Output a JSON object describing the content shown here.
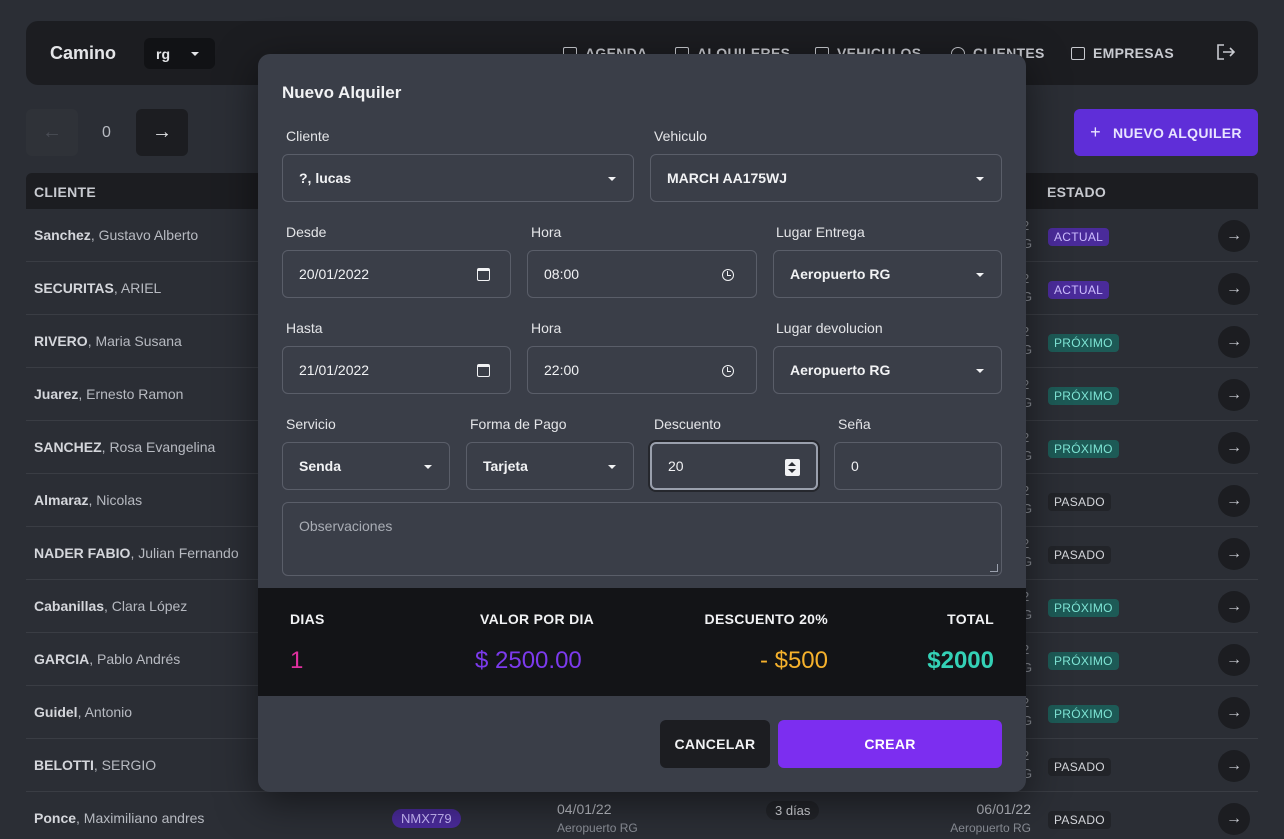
{
  "navbar": {
    "brand": "Camino",
    "company_select": "rg",
    "items": [
      {
        "label": "AGENDA"
      },
      {
        "label": "ALQUILERES"
      },
      {
        "label": "VEHICULOS"
      },
      {
        "label": "CLIENTES"
      },
      {
        "label": "EMPRESAS"
      }
    ]
  },
  "pager": {
    "page": "0",
    "prev_icon": "←",
    "next_icon": "→"
  },
  "new_button": {
    "icon": "+",
    "label": "NUEVO ALQUILER"
  },
  "table": {
    "headers": {
      "cliente": "CLIENTE",
      "estado": "ESTADO"
    },
    "rows": [
      {
        "last": "Sanchez",
        "first": ", Gustavo Alberto",
        "edge1": "2",
        "edge2": "G",
        "status": "ACTUAL"
      },
      {
        "last": "SECURITAS",
        "first": ", ARIEL",
        "edge1": "2",
        "edge2": "G",
        "status": "ACTUAL"
      },
      {
        "last": "RIVERO",
        "first": ", Maria Susana",
        "edge1": "2",
        "edge2": "G",
        "status": "PRÓXIMO"
      },
      {
        "last": "Juarez",
        "first": ", Ernesto Ramon",
        "edge1": "2",
        "edge2": "G",
        "status": "PRÓXIMO"
      },
      {
        "last": "SANCHEZ",
        "first": ", Rosa Evangelina",
        "edge1": "2",
        "edge2": "G",
        "status": "PRÓXIMO"
      },
      {
        "last": "Almaraz",
        "first": ", Nicolas",
        "edge1": "2",
        "edge2": "G",
        "status": "PASADO"
      },
      {
        "last": "NADER FABIO",
        "first": ", Julian Fernando",
        "edge1": "2",
        "edge2": "G",
        "status": "PASADO"
      },
      {
        "last": "Cabanillas",
        "first": ", Clara López",
        "edge1": "2",
        "edge2": "G",
        "status": "PRÓXIMO"
      },
      {
        "last": "GARCIA",
        "first": ", Pablo Andrés",
        "edge1": "2",
        "edge2": "G",
        "status": "PRÓXIMO"
      },
      {
        "last": "Guidel",
        "first": ", Antonio",
        "edge1": "2",
        "edge2": "G",
        "status": "PRÓXIMO"
      },
      {
        "last": "BELOTTI",
        "first": ", SERGIO",
        "edge1": "2",
        "edge2": "G",
        "status": "PASADO"
      },
      {
        "last": "Ponce",
        "first": ", Maximiliano andres",
        "plate": "NMX779",
        "from_date": "04/01/22",
        "from_place": "Aeropuerto RG",
        "days": "3 días",
        "to_date": "06/01/22",
        "to_place": "Aeropuerto RG",
        "status": "PASADO"
      }
    ],
    "row_icon": "→"
  },
  "modal": {
    "title": "Nuevo Alquiler",
    "cliente": {
      "label": "Cliente",
      "value": "?, lucas"
    },
    "vehiculo": {
      "label": "Vehiculo",
      "value": "MARCH AA175WJ"
    },
    "desde": {
      "label": "Desde",
      "value": "20/01/2022"
    },
    "hora_desde": {
      "label": "Hora",
      "value": "08:00"
    },
    "lugar_entrega": {
      "label": "Lugar Entrega",
      "value": "Aeropuerto RG"
    },
    "hasta": {
      "label": "Hasta",
      "value": "21/01/2022"
    },
    "hora_hasta": {
      "label": "Hora",
      "value": "22:00"
    },
    "lugar_devolucion": {
      "label": "Lugar devolucion",
      "value": "Aeropuerto RG"
    },
    "servicio": {
      "label": "Servicio",
      "value": "Senda"
    },
    "forma_pago": {
      "label": "Forma de Pago",
      "value": "Tarjeta"
    },
    "descuento": {
      "label": "Descuento",
      "value": "20"
    },
    "sena": {
      "label": "Seña",
      "value": "0"
    },
    "observaciones": {
      "placeholder": "Observaciones"
    },
    "summary": {
      "dias": {
        "label": "DIAS",
        "value": "1",
        "color": "#e0309f"
      },
      "valor": {
        "label": "VALOR POR DIA",
        "value": "$ 2500.00",
        "color": "#7c3aed"
      },
      "descuento": {
        "label": "DESCUENTO 20%",
        "value": "- $500",
        "color": "#f5b12c"
      },
      "total": {
        "label": "TOTAL",
        "value": "$2000",
        "color": "#34d1b6"
      }
    },
    "cancel": "CANCELAR",
    "create": "CREAR"
  },
  "colors": {
    "accent": "#7c2ef0",
    "background": "#2b2e35",
    "modal": "#3a3e48"
  }
}
